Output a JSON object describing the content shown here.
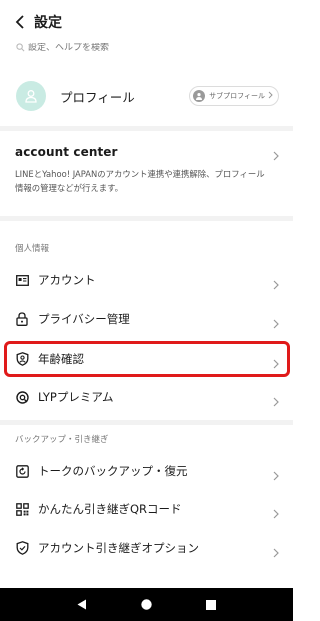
{
  "header": {
    "title": "設定"
  },
  "search": {
    "placeholder": "設定、ヘルプを検索"
  },
  "profile": {
    "name": "プロフィール",
    "subprofile_label": "サブプロフィール"
  },
  "account_center": {
    "title": "account center",
    "description": "LINEとYahoo! JAPANのアカウント連携や連携解除、プロフィール情報の管理などが行えます。"
  },
  "sections": [
    {
      "label": "個人情報",
      "items": [
        {
          "label": "アカウント",
          "icon": "id-card-icon"
        },
        {
          "label": "プライバシー管理",
          "icon": "lock-icon"
        },
        {
          "label": "年齢確認",
          "icon": "shield-check-icon",
          "highlighted": true
        },
        {
          "label": "LYPプレミアム",
          "icon": "premium-icon"
        }
      ]
    },
    {
      "label": "バックアップ・引き継ぎ",
      "items": [
        {
          "label": "トークのバックアップ・復元",
          "icon": "backup-icon"
        },
        {
          "label": "かんたん引き継ぎQRコード",
          "icon": "qr-code-icon"
        },
        {
          "label": "アカウント引き継ぎオプション",
          "icon": "shield-icon"
        }
      ]
    }
  ],
  "colors": {
    "highlight": "#e01a1a",
    "avatar_bg": "#c9ebe3"
  }
}
